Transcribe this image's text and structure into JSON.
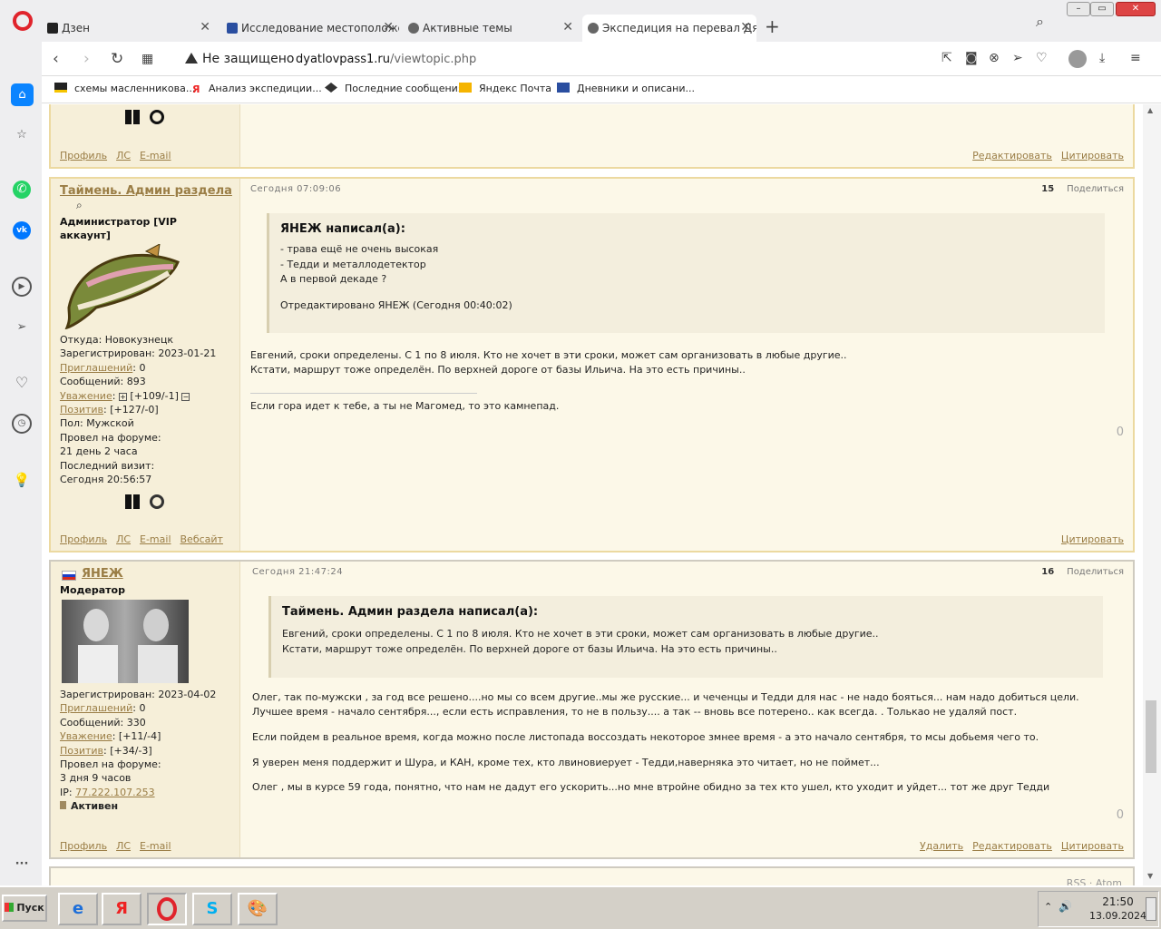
{
  "browser": {
    "tabs": [
      {
        "title": "Дзен"
      },
      {
        "title": "Исследование местоположе"
      },
      {
        "title": "Активные темы"
      },
      {
        "title": "Экспедиция на перевал Дят"
      }
    ],
    "security": "Не защищено",
    "url_host": "dyatlovpass1.ru",
    "url_path": "/viewtopic.php",
    "bookmarks": [
      {
        "label": "схемы масленникова..."
      },
      {
        "label": "Анализ экспедиции..."
      },
      {
        "label": "Последние сообщения"
      },
      {
        "label": "Яндекс Почта"
      },
      {
        "label": "Дневники и описани..."
      }
    ],
    "accent": "#0a84ff"
  },
  "top_post": {
    "links": [
      "Профиль",
      "ЛС",
      "E-mail"
    ],
    "actions": [
      "Редактировать",
      "Цитировать"
    ]
  },
  "post15": {
    "author": "Таймень. Админ раздела",
    "role": "Администратор [VIP аккаунт]",
    "from": "Откуда: Новокузнецк",
    "registered": "Зарегистрирован: 2023-01-21",
    "invites_label": "Приглашений",
    "invites_value": ": 0",
    "messages": "Сообщений: 893",
    "respect_label": "Уважение",
    "respect_value": "[+109/-1]",
    "positive_label": "Позитив",
    "positive_value": ": [+127/-0]",
    "gender": "Пол: Мужской",
    "forum_time_label": "Провел на форуме:",
    "forum_time": "21 день 2 часа",
    "last_visit_label": "Последний визит:",
    "last_visit": "Сегодня 20:56:57",
    "date": "Сегодня 07:09:06",
    "number": "15",
    "share": "Поделиться",
    "quote_author": "ЯНЕЖ написал(а):",
    "quote_lines": [
      "-  трава ещё не очень высокая",
      "-  Тедди и металлодетектор",
      "А в первой декаде ?"
    ],
    "quote_edit": "Отредактировано ЯНЕЖ (Сегодня 00:40:02)",
    "text_lines": [
      "Евгений, сроки определены. С 1 по 8 июля. Кто не хочет в эти сроки, может сам организовать в любые другие..",
      "Кстати, маршрут тоже определён. По верхней дороге от базы Ильича. На это есть причины.."
    ],
    "signature": "Если гора идет к тебе, а ты не Магомед, то это камнепад.",
    "likes": "0",
    "links": [
      "Профиль",
      "ЛС",
      "E-mail",
      "Вебсайт"
    ],
    "actions": [
      "Цитировать"
    ]
  },
  "post16": {
    "author": "ЯНЕЖ",
    "role": "Модератор",
    "registered": "Зарегистрирован: 2023-04-02",
    "invites_label": "Приглашений",
    "invites_value": ": 0",
    "messages": "Сообщений: 330",
    "respect_label": "Уважение",
    "respect_value": ": [+11/-4]",
    "positive_label": "Позитив",
    "positive_value": ": [+34/-3]",
    "forum_time_label": "Провел на форуме:",
    "forum_time": "3 дня 9 часов",
    "ip_label": "IP: ",
    "ip": "77.222.107.253",
    "status": "Активен",
    "date": "Сегодня 21:47:24",
    "number": "16",
    "share": "Поделиться",
    "quote_author": "Таймень. Админ раздела написал(а):",
    "quote_lines": [
      "Евгений, сроки определены. С 1 по 8 июля. Кто не хочет в эти сроки, может сам организовать в любые другие..",
      "Кстати, маршрут тоже определён. По верхней дороге от базы Ильича. На это есть причины.."
    ],
    "text_lines": [
      "Олег, так по-мужски ,  за год все решено....но мы  со всем  другие..мы же русские... и чеченцы и Тедди для  нас - не надо бояться... нам надо добиться цели.",
      "Лучшее время - начало сентября..., если есть исправления, то не в пользу.... а так -- вновь все потерено.. как всегда.   . Толькао не удаляй пост.",
      "Если пойдем в реальное время, когда можно после листопада воссоздать некоторое змнее время - а это начало сентября, то  мсы добьемя чего то.",
      "Я уверен меня поддержит и Шура, и КАН, кроме тех, кто лвиновиерует - Тедди,наверняка это читает, но не поймет...",
      "Олег , мы в курсе 59 года, понятно, что нам не дадут его ускорить...но мне втройне обидно за тех кто ушел, кто уходит и уйдет... тот же друг Тедди"
    ],
    "likes": "0",
    "links": [
      "Профиль",
      "ЛС",
      "E-mail"
    ],
    "actions": [
      "Удалить",
      "Редактировать",
      "Цитировать"
    ]
  },
  "footer": {
    "rss": "RSS",
    "atom": "Atom"
  },
  "taskbar": {
    "start": "Пуск",
    "time": "21:50",
    "date": "13.09.2024"
  }
}
